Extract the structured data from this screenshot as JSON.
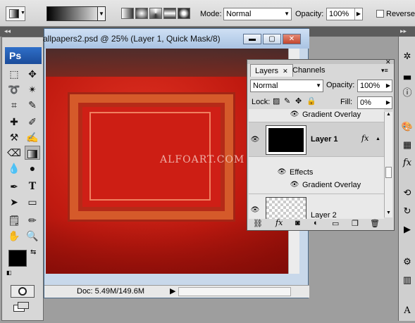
{
  "options_bar": {
    "gradient_arrow": "▼",
    "mode_label": "Mode:",
    "mode_value": "Normal",
    "opacity_label": "Opacity:",
    "opacity_value": "100%",
    "reverse_label": "Reverse"
  },
  "document": {
    "title": "allpapers2.psd @ 25% (Layer 1, Quick Mask/8)",
    "watermark": "ALFOART.COM",
    "status": "Doc: 5.49M/149.6M"
  },
  "toolbox": {
    "logo": "Ps"
  },
  "layers_panel": {
    "tabs": [
      "Layers",
      "Channels"
    ],
    "blend_mode": "Normal",
    "opacity_label": "Opacity:",
    "opacity_value": "100%",
    "lock_label": "Lock:",
    "fill_label": "Fill:",
    "fill_value": "0%",
    "rows": {
      "effect_above": "Gradient Overlay",
      "layer1": "Layer 1",
      "fx_badge": "fx",
      "effects": "Effects",
      "gradient_overlay": "Gradient Overlay",
      "layer2": "Layer 2"
    }
  },
  "colors": {
    "accent": "#1b4c9a",
    "canvas_red": "#c01a10",
    "title_bar": "#a9c3e3"
  }
}
